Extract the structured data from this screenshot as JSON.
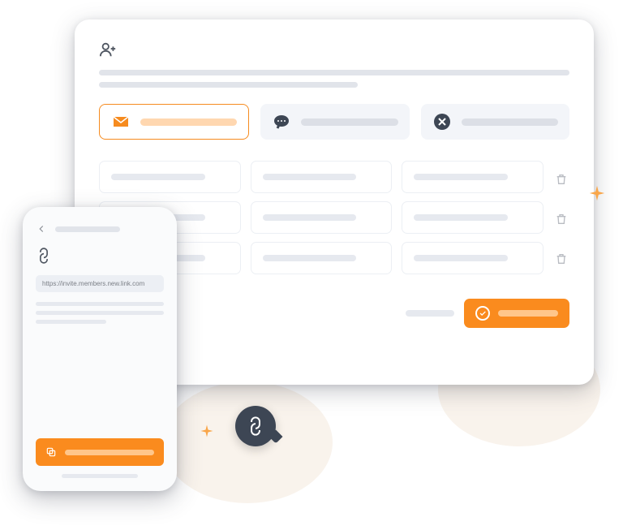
{
  "desktop": {
    "header_icon": "user-plus-icon",
    "methods": {
      "email": {
        "icon": "envelope-icon",
        "active": true
      },
      "chat": {
        "icon": "chat-icon",
        "active": false
      },
      "none": {
        "icon": "x-circle-icon",
        "active": false
      }
    },
    "rows": 3,
    "cols": 3,
    "row_action_icon": "trash-icon",
    "footer": {
      "cancel_label": "",
      "submit_label": "",
      "submit_icon": "check-circle-icon"
    }
  },
  "phone": {
    "back_icon": "arrow-left-icon",
    "link_icon": "link-icon",
    "url": "https://invite.members.new.link.com",
    "copy_button": {
      "icon": "copy-icon",
      "label": ""
    }
  },
  "decorations": {
    "floating_badge_icon": "link-icon"
  },
  "colors": {
    "accent": "#fa8b1e",
    "accent_soft": "#ffd7b0",
    "surface": "#ffffff",
    "muted": "#e1e4ea",
    "dark": "#3d4654"
  }
}
